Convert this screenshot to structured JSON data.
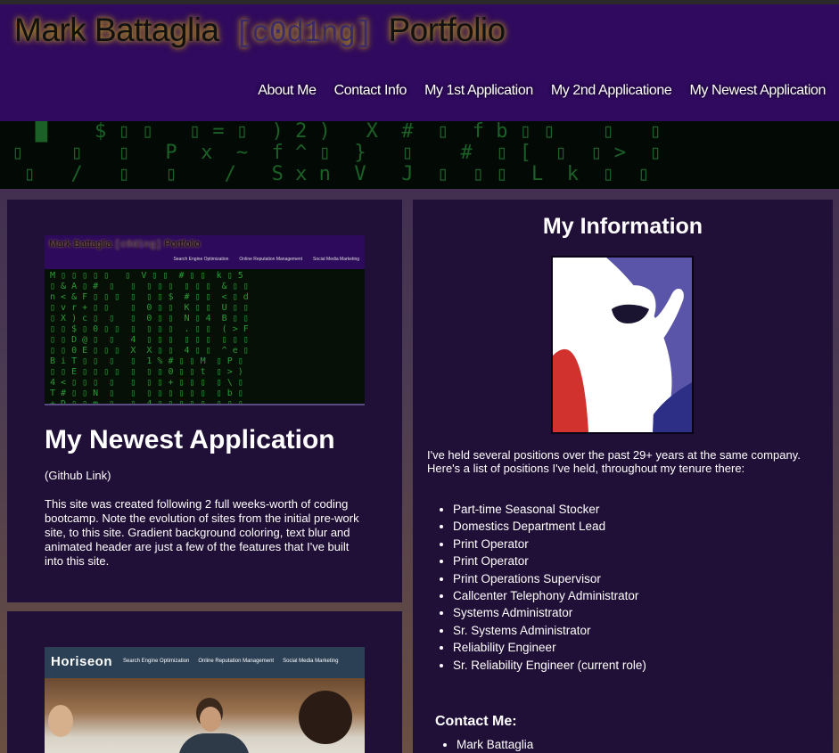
{
  "header": {
    "title_name": "Mark Battaglia",
    "title_code": "[c0d1ng]",
    "title_suffix": "Portfolio",
    "nav": [
      {
        "label": "About Me"
      },
      {
        "label": "Contact Info"
      },
      {
        "label": "My 1st Application"
      },
      {
        "label": "My 2nd Applicatione"
      },
      {
        "label": "My Newest Application"
      }
    ]
  },
  "newest_app": {
    "thumb_title_name": "Mark Battaglia",
    "thumb_title_code": "[c0d1ng]",
    "thumb_title_suffix": "Portfolio",
    "thumb_nav": [
      "Search Engine Optimization",
      "Online Reputation Management",
      "Social Media Marketing"
    ],
    "heading": "My Newest Application",
    "link": "(Github Link)",
    "description": "This site was created following 2 full weeks-worth of coding bootcamp. Note the evolution of sites from the initial pre-work site, to this site. Gradient background coloring, text blur and animated header are just a few of the features that I've built into this site."
  },
  "second_app": {
    "thumb_logo": "Horiseon",
    "thumb_nav": [
      "Search Engine Optimization",
      "Online Reputation Management",
      "Social Media Marketing"
    ]
  },
  "info": {
    "heading": "My Information",
    "intro": "I've held several positions over the past 29+ years at the same company. Here's a list of positions I've held, throughout my tenure there:",
    "positions": [
      "Part-time Seasonal Stocker",
      "Domestics Department Lead",
      "Print Operator",
      "Print Operator",
      "Print Operations Supervisor",
      "Callcenter Telephony Administrator",
      "Systems Administrator",
      "Sr. Systems Administrator",
      "Reliability Engineer",
      "Sr. Reliability Engineer (current role)"
    ],
    "contact_heading": "Contact Me:",
    "contact": [
      "Mark Battaglia"
    ]
  }
}
